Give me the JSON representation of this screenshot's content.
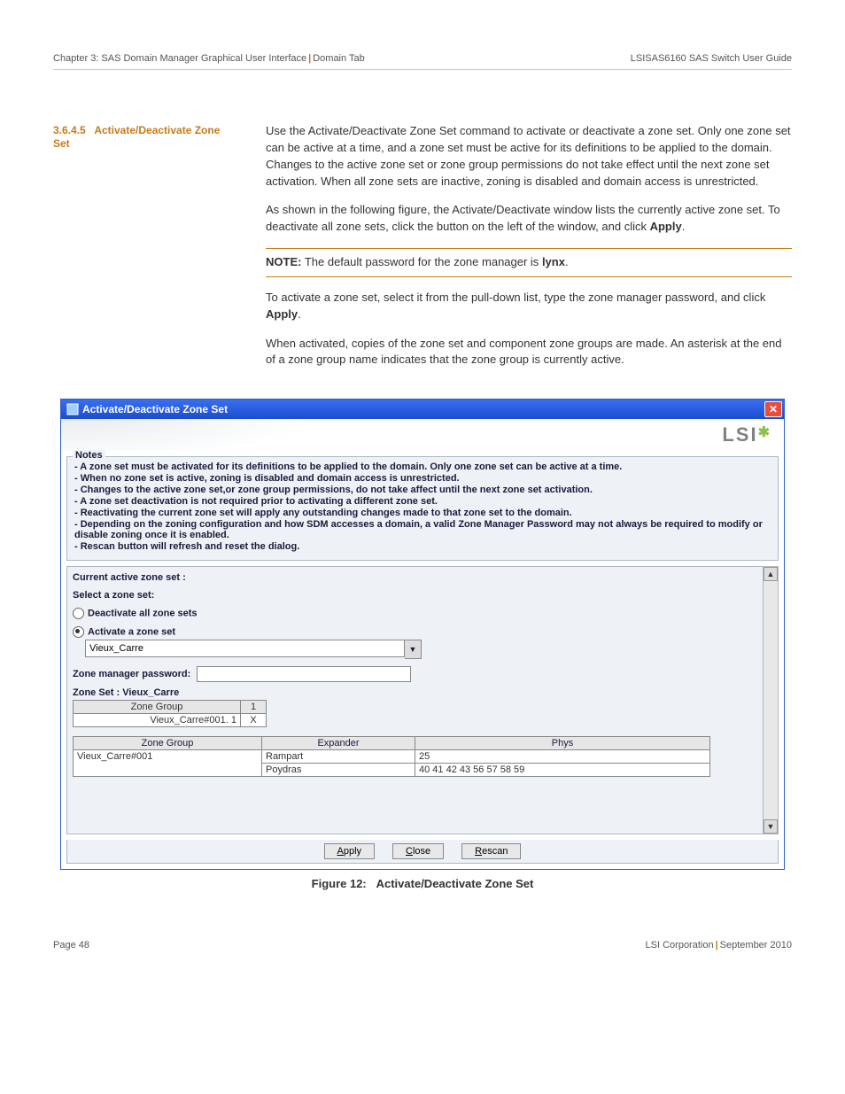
{
  "header": {
    "left_a": "Chapter 3: SAS Domain Manager Graphical User Interface",
    "left_b": "Domain Tab",
    "right": "LSISAS6160 SAS Switch User Guide"
  },
  "section": {
    "number": "3.6.4.5",
    "title": "Activate/Deactivate Zone Set"
  },
  "body": {
    "p1": "Use the Activate/Deactivate Zone Set command to activate or deactivate a zone set. Only one zone set can be active at a time, and a zone set must be active for its definitions to be applied to the domain. Changes to the active zone set or zone group permissions do not take effect until the next zone set activation. When all zone sets are inactive, zoning is disabled and domain access is unrestricted.",
    "p2_a": "As shown in the following figure, the Activate/Deactivate window lists the currently active zone set. To deactivate all zone sets, click the button on the left of the window, and click ",
    "p2_b": "Apply",
    "p2_c": ".",
    "note_prefix": "NOTE:",
    "note_a": "  The default password for the zone manager is ",
    "note_b": "lynx",
    "note_c": ".",
    "p3_a": "To activate a zone set, select it from the pull-down list, type the zone manager password, and click ",
    "p3_b": "Apply",
    "p3_c": ".",
    "p4": "When activated, copies of the zone set and component zone groups are made. An asterisk at the end of a zone group name indicates that the zone group is currently active."
  },
  "window": {
    "title": "Activate/Deactivate Zone Set",
    "logo": "LSI",
    "notes_legend": "Notes",
    "notes": [
      "- A zone set must be activated for its definitions to be applied to the domain. Only one zone set can be active at a time.",
      "- When no zone set is active, zoning is disabled and domain access is unrestricted.",
      "- Changes to the active zone set,or zone group permissions, do not take affect until the next zone set activation.",
      "- A zone set deactivation is not required prior to activating a different zone set.",
      "- Reactivating the current zone set will apply any outstanding changes made to that zone set to the domain.",
      "- Depending on the zoning configuration and how SDM accesses a domain, a valid Zone Manager Password may not always be required to modify or disable zoning once it is enabled.",
      "- Rescan button will refresh and reset the dialog."
    ],
    "current_label": "Current active zone set :",
    "select_label": "Select a zone set:",
    "radio_deactivate": "Deactivate all zone sets",
    "radio_activate": "Activate a zone set",
    "dropdown_value": "Vieux_Carre",
    "pwd_label": "Zone manager password:",
    "zoneset_label": "Zone Set : Vieux_Carre",
    "t1": {
      "h1": "Zone Group",
      "h2": "1",
      "r1c1": "Vieux_Carre#001. 1",
      "r1c2": "X"
    },
    "t2": {
      "h1": "Zone Group",
      "h2": "Expander",
      "h3": "Phys",
      "r1": {
        "c1": "Vieux_Carre#001",
        "c2": "Rampart",
        "c3": "25"
      },
      "r2": {
        "c1": "",
        "c2": "Poydras",
        "c3": "40 41 42 43 56 57 58 59"
      }
    },
    "btn_apply": "Apply",
    "btn_close": "Close",
    "btn_rescan": "Rescan"
  },
  "caption": {
    "label": "Figure 12:",
    "text": "Activate/Deactivate Zone Set"
  },
  "footer": {
    "page": "Page 48",
    "corp": "LSI Corporation",
    "date": "September 2010"
  }
}
